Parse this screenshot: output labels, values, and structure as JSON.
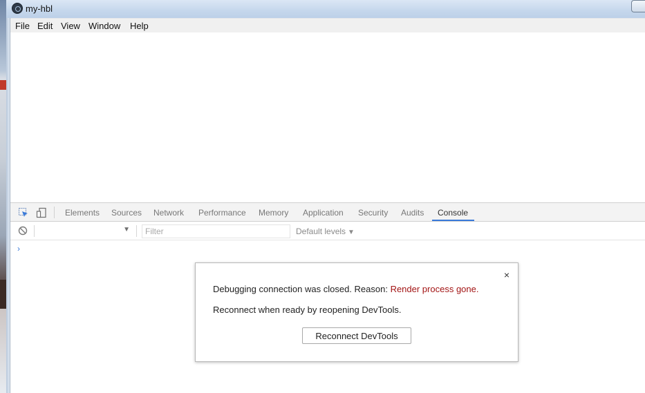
{
  "window": {
    "title": "my-hbl",
    "app_icon": "electron-icon"
  },
  "menubar": {
    "items": [
      "File",
      "Edit",
      "View",
      "Window",
      "Help"
    ]
  },
  "devtools": {
    "tools": {
      "inspect_icon": "inspect-element-icon",
      "device_icon": "device-toolbar-icon"
    },
    "tabs": [
      "Elements",
      "Sources",
      "Network",
      "Performance",
      "Memory",
      "Application",
      "Security",
      "Audits",
      "Console"
    ],
    "active_tab": "Console",
    "accent_color": "#3879d9",
    "console_toolbar": {
      "clear_icon": "clear-console-icon",
      "context_value": "",
      "filter_placeholder": "Filter",
      "levels_label": "Default levels",
      "levels_arrow": "▼"
    },
    "prompt_symbol": "›"
  },
  "dialog": {
    "message_prefix": "Debugging connection was closed. Reason: ",
    "reason": "Render process gone.",
    "reason_color": "#a31515",
    "message_reconnect": "Reconnect when ready by reopening DevTools.",
    "button_label": "Reconnect DevTools",
    "close_symbol": "×"
  }
}
